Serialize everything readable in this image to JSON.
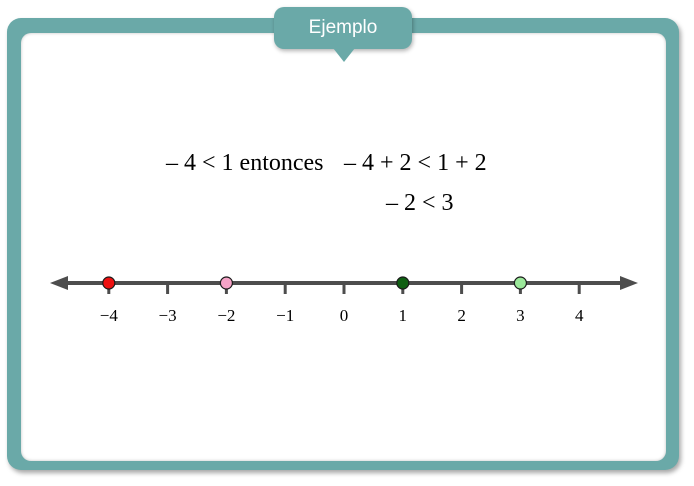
{
  "header": {
    "title": "Ejemplo"
  },
  "equations": {
    "line1_left": "– 4 < 1 entonces",
    "line1_right": "– 4 + 2 < 1 + 2",
    "line2": "– 2 < 3"
  },
  "number_line": {
    "ticks": [
      {
        "value": -4,
        "label": "−4"
      },
      {
        "value": -3,
        "label": "−3"
      },
      {
        "value": -2,
        "label": "−2"
      },
      {
        "value": -1,
        "label": "−1"
      },
      {
        "value": 0,
        "label": "0"
      },
      {
        "value": 1,
        "label": "1"
      },
      {
        "value": 2,
        "label": "2"
      },
      {
        "value": 3,
        "label": "3"
      },
      {
        "value": 4,
        "label": "4"
      }
    ],
    "points": [
      {
        "value": -4,
        "color": "#ee1111"
      },
      {
        "value": -2,
        "color": "#f5a3c7"
      },
      {
        "value": 1,
        "color": "#0f5f12"
      },
      {
        "value": 3,
        "color": "#9be89a"
      }
    ],
    "line_color": "#4d4d4d"
  }
}
